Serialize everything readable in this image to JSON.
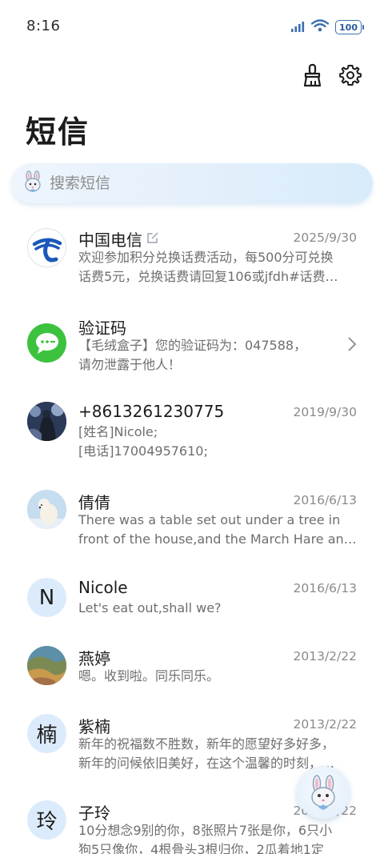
{
  "status": {
    "time": "8:16",
    "battery": "100"
  },
  "header": {
    "title": "短信"
  },
  "search": {
    "placeholder": "搜索短信"
  },
  "conversations": [
    {
      "name": "中国电信",
      "date": "2025/9/30",
      "line1": "欢迎参加积分兑换话费活动，每500分可兑换",
      "line2": "话费5元，兑换话费请回复106或jfdh#话费…",
      "avatar": "china-telecom-logo"
    },
    {
      "name": "验证码",
      "date": "",
      "line1": "【毛绒盒子】您的验证码为：047588，",
      "line2": "请勿泄露于他人！",
      "avatar": "message-bubble-icon"
    },
    {
      "name": "+8613261230775",
      "date": "2019/9/30",
      "line1": "[姓名]Nicole;",
      "line2": "[电话]17004957610;",
      "avatar": "contact-photo"
    },
    {
      "name": "倩倩",
      "date": "2016/6/13",
      "line1": "There was a table set out under a tree in",
      "line2": "front of the house,and the March Hare an…",
      "avatar": "polar-bear-photo"
    },
    {
      "name": "Nicole",
      "date": "2016/6/13",
      "line1": "Let's eat out,shall we?",
      "line2": "",
      "avatar": "N"
    },
    {
      "name": "燕婷",
      "date": "2013/2/22",
      "line1": "嗯。收到啦。同乐同乐。",
      "line2": "",
      "avatar": "landscape-photo"
    },
    {
      "name": "紫楠",
      "date": "2013/2/22",
      "line1": "新年的祝福数不胜数，新年的愿望好多好多，",
      "line2": "新年的问候依旧美好，在这个温馨的时刻，…",
      "avatar": "楠"
    },
    {
      "name": "子玲",
      "date": "2013/2/22",
      "line1": "10分想念9别的你，8张照片7张是你，6只小",
      "line2": "狗5只像你，4根骨头3根归你，2瓜着地1定",
      "avatar": "玲"
    }
  ],
  "colors": {
    "accent": "#2a5c9e",
    "search_bg": "#e2effb",
    "avatar_bg": "#dcebfb",
    "green": "#3cc23f"
  }
}
